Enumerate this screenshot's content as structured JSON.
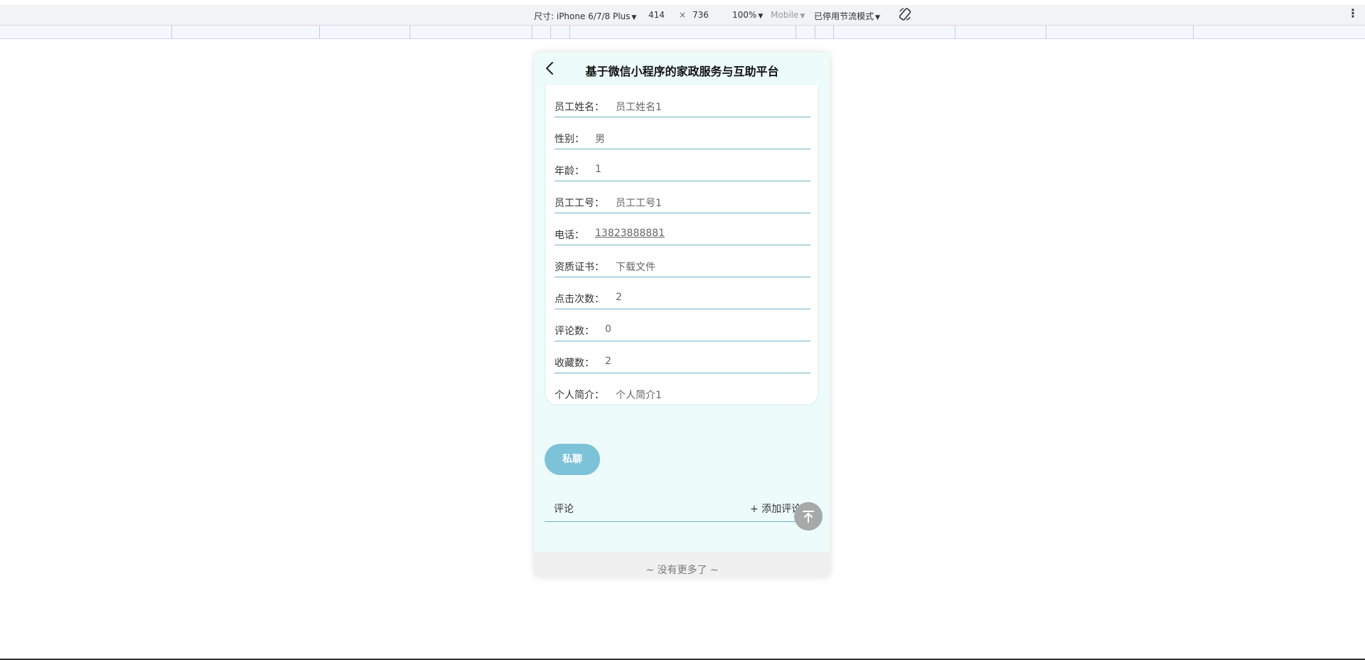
{
  "devtools": {
    "device": "尺寸: iPhone 6/7/8 Plus",
    "width": "414",
    "x": "×",
    "height": "736",
    "zoom": "100%",
    "mode": "Mobile",
    "throttle": "已停用节流模式",
    "more": "⋮"
  },
  "nav": {
    "title": "基于微信小程序的家政服务与互助平台"
  },
  "detail": {
    "rows": [
      {
        "label": "员工姓名：",
        "value": "员工姓名1"
      },
      {
        "label": "性别：",
        "value": "男"
      },
      {
        "label": "年龄：",
        "value": "1"
      },
      {
        "label": "员工工号：",
        "value": "员工工号1"
      },
      {
        "label": "电话：",
        "value": "13823888881"
      },
      {
        "label": "资质证书：",
        "value": "下载文件"
      },
      {
        "label": "点击次数：",
        "value": "2"
      },
      {
        "label": "评论数：",
        "value": "0"
      },
      {
        "label": "收藏数：",
        "value": "2"
      },
      {
        "label": "个人简介：",
        "value": "个人简介1"
      }
    ]
  },
  "actions": {
    "chat_label": "私聊"
  },
  "comments": {
    "title": "评论",
    "add_label": "+ 添加评论"
  },
  "footer": {
    "text": "~ 没有更多了 ~"
  }
}
